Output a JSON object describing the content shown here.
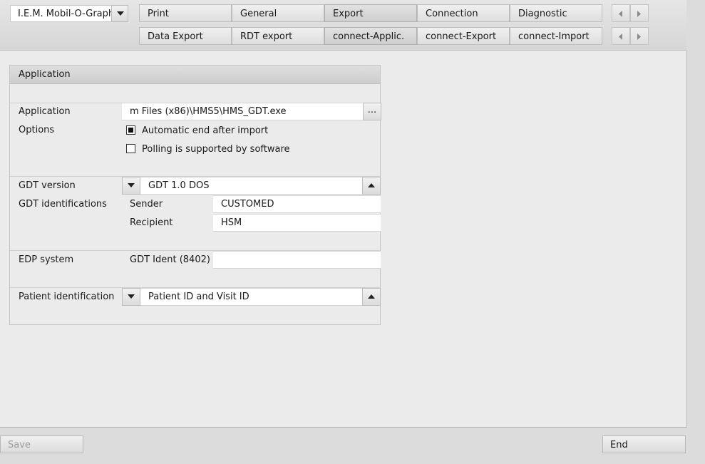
{
  "device_selector": {
    "value": "I.E.M. Mobil-O-Graph"
  },
  "tabs_row1": [
    "Print",
    "General",
    "Export",
    "Connection",
    "Diagnostic"
  ],
  "tabs_row2": [
    "Data Export",
    "RDT export",
    "connect-Applic.",
    "connect-Export",
    "connect-Import"
  ],
  "active_tab_row1": "Export",
  "active_tab_row2": "connect-Applic.",
  "panel": {
    "title": "Application",
    "application_label": "Application",
    "application_path": "m Files (x86)\\HMS5\\HMS_GDT.exe",
    "browse_label": "...",
    "options_label": "Options",
    "option_auto_end": {
      "label": "Automatic end after import",
      "checked": true
    },
    "option_polling": {
      "label": "Polling is supported by software",
      "checked": false
    },
    "gdt_version_label": "GDT version",
    "gdt_version_value": "GDT 1.0 DOS",
    "gdt_identifications_label": "GDT identifications",
    "sender_label": "Sender",
    "sender_value": "CUSTOMED",
    "recipient_label": "Recipient",
    "recipient_value": "HSM",
    "edp_system_label": "EDP system",
    "gdt_ident_label": "GDT Ident (8402)",
    "gdt_ident_value": "",
    "patient_identification_label": "Patient identification",
    "patient_identification_value": "Patient ID and Visit ID"
  },
  "footer": {
    "save_label": "Save",
    "end_label": "End"
  },
  "icons": {
    "dropdown": "triangle-down-icon",
    "spin_up": "triangle-up-icon",
    "scroll_left": "triangle-left-icon",
    "scroll_right": "triangle-right-icon"
  }
}
